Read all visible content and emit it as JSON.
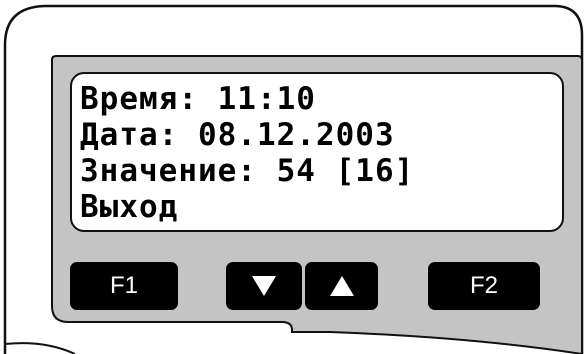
{
  "display": {
    "lines": [
      "Время: 11:10",
      "Дата: 08.12.2003",
      "Значение: 54 [16]",
      "Выход"
    ]
  },
  "keys": {
    "f1_label": "F1",
    "f2_label": "F2",
    "down_icon": "triangle-down-icon",
    "up_icon": "triangle-up-icon"
  },
  "colors": {
    "panel": "#c4c4c4",
    "screen": "#ffffff",
    "key": "#000000",
    "key_text": "#ffffff"
  }
}
